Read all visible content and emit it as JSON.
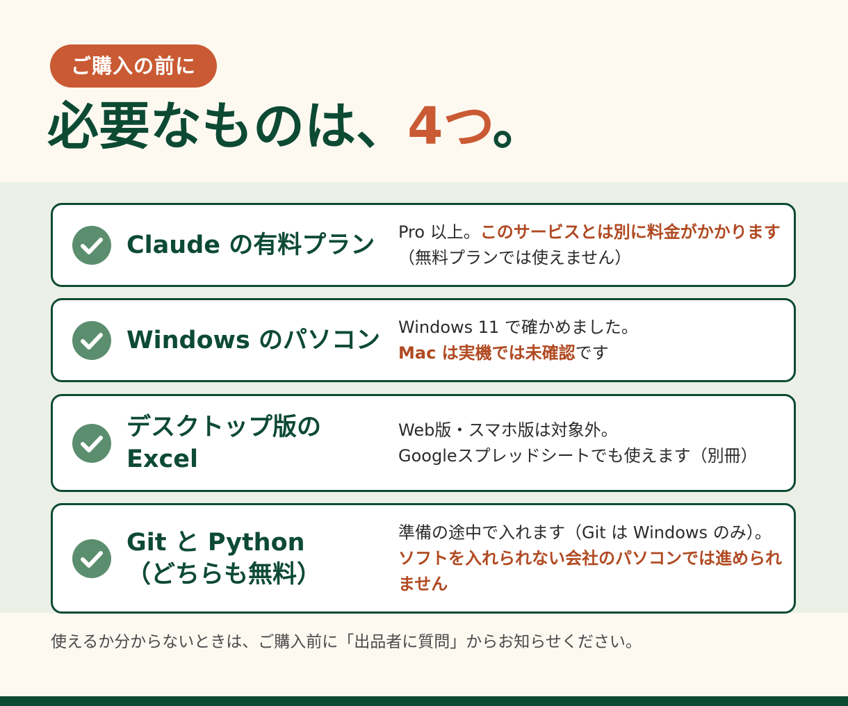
{
  "badge": {
    "label": "ご購入の前に"
  },
  "title": {
    "main": "必要なものは、",
    "count": "4つ",
    "end": "。"
  },
  "requirements": [
    {
      "name_lines": [
        "Claude の有料プラン"
      ],
      "note_parts": [
        {
          "text": "Pro 以上。",
          "warn": false
        },
        {
          "text": "このサービスとは別に料金がかかります",
          "warn": true
        },
        {
          "text": "（無料プランでは使えません）",
          "warn": false
        }
      ]
    },
    {
      "name_lines": [
        "Windows のパソコン"
      ],
      "note_parts": [
        {
          "text": "Windows 11 で確かめました。",
          "warn": false,
          "br_after": true
        },
        {
          "text": "Mac は実機では未確認",
          "warn": true
        },
        {
          "text": "です",
          "warn": false
        }
      ]
    },
    {
      "name_lines": [
        "デスクトップ版の",
        "Excel"
      ],
      "note_parts": [
        {
          "text": "Web版・スマホ版は対象外。",
          "warn": false,
          "br_after": true
        },
        {
          "text": "Googleスプレッドシートでも使えます（別冊）",
          "warn": false
        }
      ]
    },
    {
      "name_lines": [
        "Git と Python",
        "（どちらも無料）"
      ],
      "note_parts": [
        {
          "text": "準備の途中で入れます（Git は Windows のみ）。",
          "warn": false,
          "br_after": true
        },
        {
          "text": "ソフトを入れられない会社のパソコンでは進められません",
          "warn": true
        }
      ]
    }
  ],
  "footer": {
    "note": "使えるか分からないときは、ご購入前に「出品者に質問」からお知らせください。"
  },
  "icons": {
    "requirement": "check-circle-icon"
  },
  "colors": {
    "brand_green": "#0d4a34",
    "accent_orange": "#c95a33",
    "warn_text": "#b04a22",
    "check_fill": "#5b8e6e",
    "band_bg": "#ebf0e6",
    "page_bg": "#fdf9f1"
  }
}
